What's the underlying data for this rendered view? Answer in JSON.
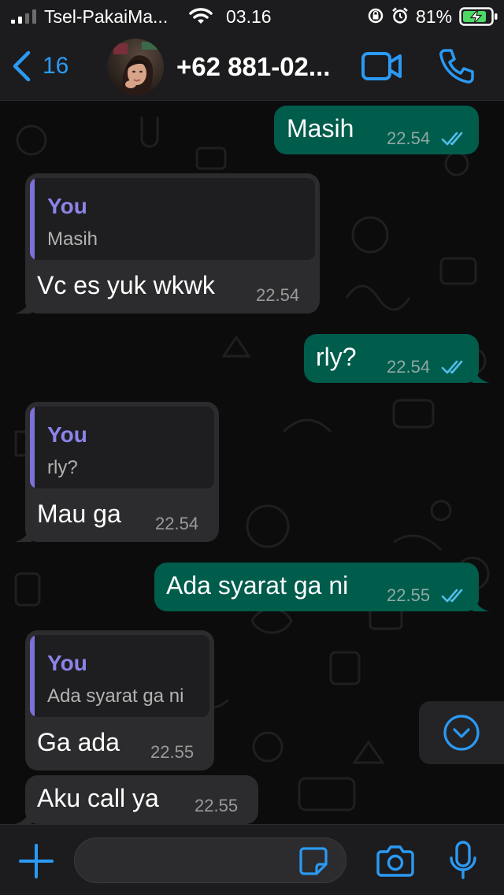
{
  "status_bar": {
    "carrier": "Tsel-PakaiMa...",
    "time": "03.16",
    "battery": "81%"
  },
  "header": {
    "back_count": "16",
    "contact_name": "+62 881-02...",
    "accent_color": "#2b9af3"
  },
  "messages": [
    {
      "direction": "out",
      "text": "Masih",
      "time": "22.54",
      "status": "read"
    },
    {
      "direction": "in",
      "reply_to": {
        "author": "You",
        "text": "Masih"
      },
      "text": "Vc es yuk wkwk",
      "time": "22.54"
    },
    {
      "direction": "out",
      "text": "rly?",
      "time": "22.54",
      "status": "read"
    },
    {
      "direction": "in",
      "reply_to": {
        "author": "You",
        "text": "rly?"
      },
      "text": "Mau ga",
      "time": "22.54"
    },
    {
      "direction": "out",
      "text": "Ada syarat ga ni",
      "time": "22.55",
      "status": "read"
    },
    {
      "direction": "in",
      "reply_to": {
        "author": "You",
        "text": "Ada syarat ga ni"
      },
      "text": "Ga ada",
      "time": "22.55"
    },
    {
      "direction": "in",
      "text": "Aku call ya",
      "time": "22.55"
    }
  ],
  "composer": {
    "placeholder": "",
    "value": ""
  },
  "icons": {
    "back": "chevron-left-icon",
    "video": "video-camera-icon",
    "call": "phone-icon",
    "scroll": "chevron-down-circle-icon",
    "attach": "plus-icon",
    "sticker": "sticker-icon",
    "camera": "camera-icon",
    "mic": "microphone-icon"
  },
  "colors": {
    "outgoing_bubble": "#005c4b",
    "incoming_bubble": "#2c2c2e",
    "quote_author": "#8c84e8",
    "read_ticks": "#53bdeb"
  }
}
